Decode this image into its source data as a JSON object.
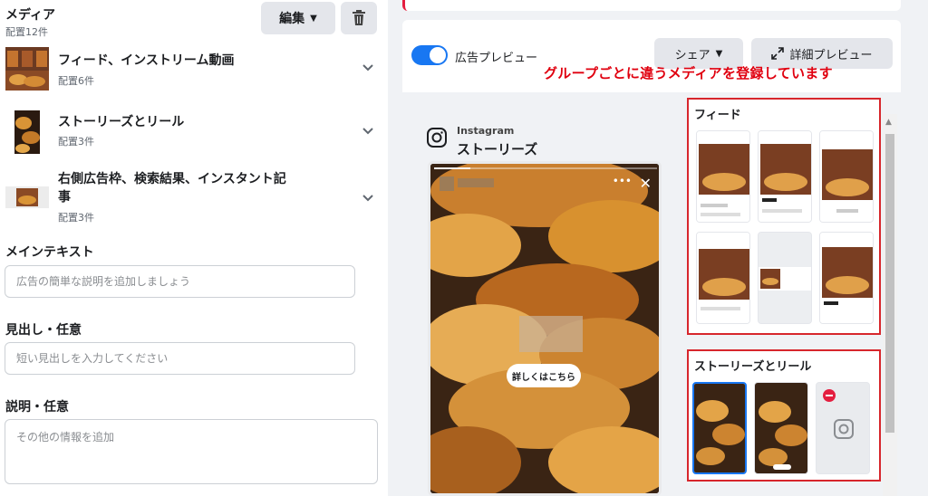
{
  "media": {
    "title": "メディア",
    "count": "配置12件",
    "edit_label": "編集",
    "groups": [
      {
        "label": "フィード、インストリーム動画",
        "sub": "配置6件"
      },
      {
        "label": "ストーリーズとリール",
        "sub": "配置3件"
      },
      {
        "label_line1": "右側広告枠、検索結果、インスタント記",
        "label_line2": "事",
        "sub": "配置3件"
      }
    ]
  },
  "fields": {
    "main_text_label": "メインテキスト",
    "main_text_placeholder": "広告の簡単な説明を追加しましょう",
    "headline_label": "見出し・任意",
    "headline_placeholder": "短い見出しを入力してください",
    "description_label": "説明・任意",
    "description_placeholder": "その他の情報を追加"
  },
  "preview": {
    "toggle_label": "広告プレビュー",
    "share_label": "シェア",
    "detail_label": "詳細プレビュー",
    "annotation": "グループごとに違うメディアを登録しています",
    "platform_name": "Instagram",
    "placement_name": "ストーリーズ",
    "cta_label": "詳しくはこちら",
    "feed_group_title": "フィード",
    "stories_group_title": "ストーリーズとリール"
  },
  "colors": {
    "accent": "#1877f2",
    "annotation_red": "#e0000f",
    "box_red": "#d7262c",
    "panel_bg": "#f0f2f5"
  }
}
